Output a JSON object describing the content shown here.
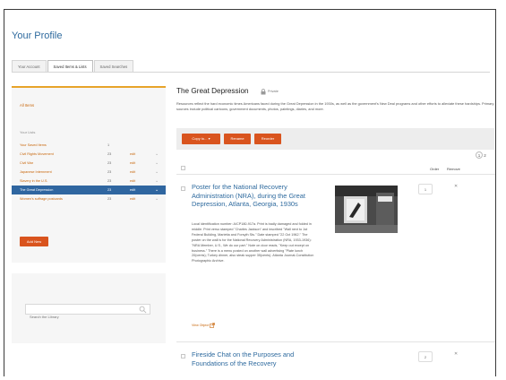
{
  "page": {
    "title": "Your Profile"
  },
  "tabs": [
    {
      "label": "Your Account",
      "active": false
    },
    {
      "label": "Saved Items & Lists",
      "active": true
    },
    {
      "label": "Saved Searches",
      "active": false
    }
  ],
  "sidebar": {
    "all_items": "All Items",
    "your_lists": "Your Lists",
    "lists": [
      {
        "name": "Your Saved Items",
        "count": "1",
        "edit": ""
      },
      {
        "name": "Civil Rights Movement",
        "count": "23",
        "edit": "edit"
      },
      {
        "name": "Civil War",
        "count": "23",
        "edit": "edit"
      },
      {
        "name": "Japanese Internment",
        "count": "23",
        "edit": "edit"
      },
      {
        "name": "Slavery in the U.S.",
        "count": "23",
        "edit": "edit"
      },
      {
        "name": "The Great Depression",
        "count": "23",
        "edit": "edit",
        "active": true
      },
      {
        "name": "Women's suffrage postcards",
        "count": "23",
        "edit": "edit"
      }
    ],
    "add_new": "Add New",
    "search_placeholder": "Search the Library"
  },
  "main": {
    "title": "The Great Depression",
    "privacy": "Private",
    "description": "Resources reflect the hard economic times Americans faced during the Great Depression in the 1930s, as well as the government's New Deal programs and other efforts to alleviate these hardships. Primary sources include political cartoons, government documents, photos, paintings, diaries, and more.",
    "toolbar": {
      "copy_to": "Copy to...  ▾",
      "rename": "Rename",
      "reorder": "Reorder"
    },
    "pager": {
      "current": "1",
      "next": "2"
    },
    "columns": {
      "order": "Order",
      "remove": "Remove"
    },
    "items": [
      {
        "title": "Poster for the National Recovery Administration (NRA), during the Great Depression, Atlanta, Georgia, 1930s",
        "description": "Local identification number: A/CP180-917a. Print is badly damaged and folded in middle. Print verso stamped \"Charles Jackson\" and inscribed \"Wall next to 1st Federal Building, Marietta and Forsyth Sts.\" Date stamped \"22 Oct 1962.\" The poster on the wall is for the National Recovery Administration (NRA, 1933-1936): \"NRA Member, U.S., We do our part.\" Note on door reads, \"Keep out except on business.\" There is a menu posted on another wall advertising \"Plate lunch 20(cents); Turkey dinner, also steak supper 35(cents). Atlanta Journal-Constitution Photographic Archive.",
        "view": "View Object",
        "order": "1",
        "remove": "✕"
      },
      {
        "title": "Fireside Chat on the Purposes and Foundations of the Recovery",
        "order": "2",
        "remove": "✕"
      }
    ]
  },
  "colors": {
    "accent": "#d9541e",
    "link": "#2e6a9e",
    "active_row": "#2f66a0",
    "top_border": "#e7a42a"
  }
}
